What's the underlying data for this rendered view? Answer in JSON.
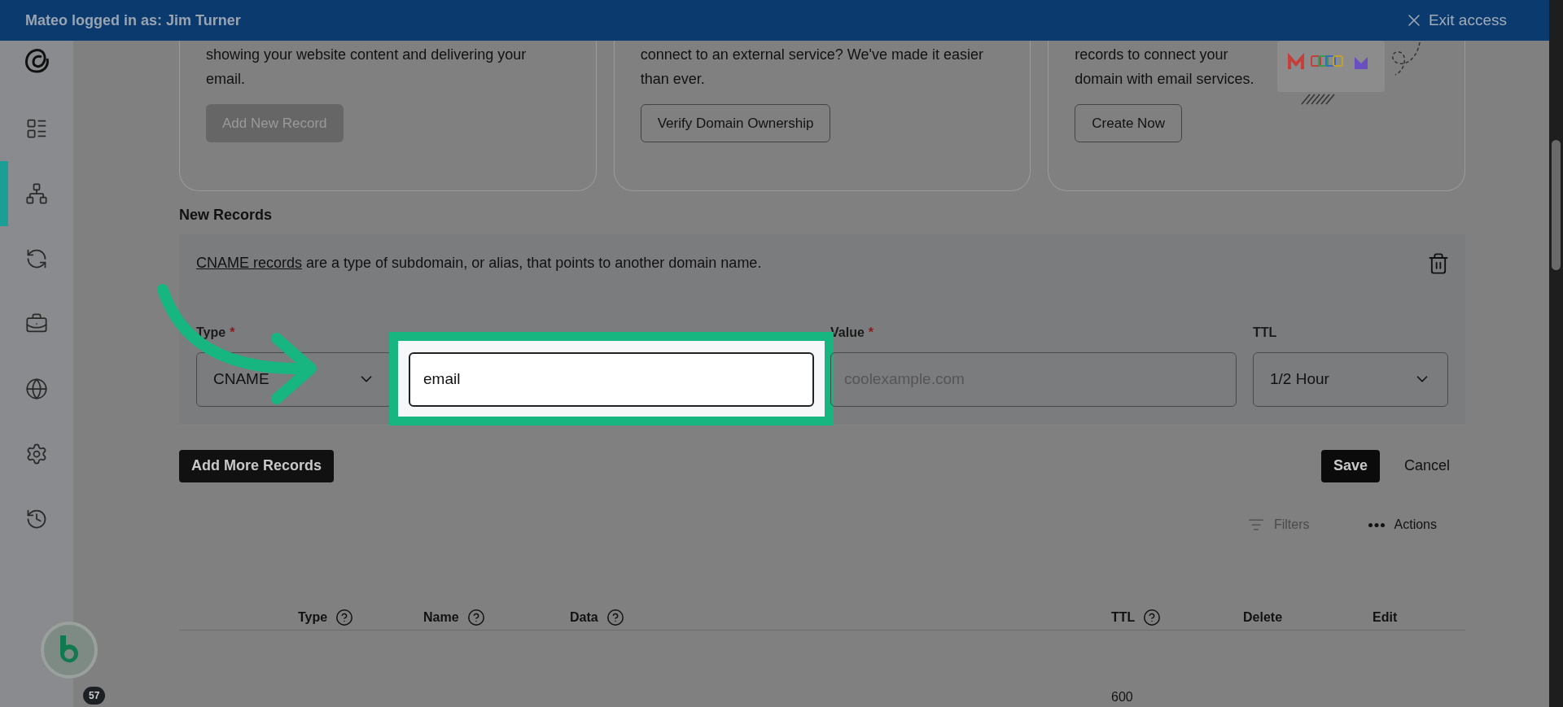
{
  "banner": {
    "text": "Mateo logged in as: Jim Turner",
    "exit": "Exit access"
  },
  "sidebar": {
    "items": [
      {
        "kind": "list",
        "selected": false
      },
      {
        "kind": "sitemap",
        "selected": true
      },
      {
        "kind": "sync",
        "selected": false
      },
      {
        "kind": "briefcase",
        "selected": false
      },
      {
        "kind": "globe",
        "selected": false
      },
      {
        "kind": "settings",
        "selected": false
      },
      {
        "kind": "history",
        "selected": false
      }
    ]
  },
  "cards": [
    {
      "text": "showing your website content and delivering your email.",
      "button": "Add New Record",
      "disabled": true,
      "art": false
    },
    {
      "text": "connect to an external service? We've made it easier than ever.",
      "button": "Verify Domain Ownership",
      "disabled": false,
      "art": false
    },
    {
      "text": "records to connect your domain with email services.",
      "button": "Create Now",
      "disabled": false,
      "art": true
    }
  ],
  "new_records": {
    "title": "New Records",
    "link": "CNAME records",
    "description": "are a type of subdomain, or alias, that points to another domain name.",
    "fields": [
      {
        "kind": "select",
        "label": "Type",
        "required_mark": "*",
        "value": "CNAME"
      },
      {
        "kind": "input",
        "value": "email",
        "highlighted": true
      },
      {
        "kind": "input",
        "label": "Value",
        "required_mark": "*",
        "placeholder": "coolexample.com",
        "highlighted": false
      },
      {
        "kind": "select",
        "label": "TTL",
        "value": "1/2 Hour"
      }
    ]
  },
  "buttons": {
    "add_more": "Add More Records",
    "save": "Save",
    "cancel": "Cancel"
  },
  "toolbar": {
    "filters": "Filters",
    "filters_disabled": true,
    "actions": "Actions"
  },
  "table": {
    "columns": [
      {
        "label": "Type",
        "help": true
      },
      {
        "label": "Name",
        "help": true
      },
      {
        "label": "Data",
        "help": true
      },
      {
        "label": "TTL",
        "help": true
      },
      {
        "label": "Delete",
        "help": false
      },
      {
        "label": "Edit",
        "help": false
      }
    ],
    "rows": [
      {
        "ttl": "600"
      }
    ]
  },
  "assistant": {
    "badge": "57"
  }
}
